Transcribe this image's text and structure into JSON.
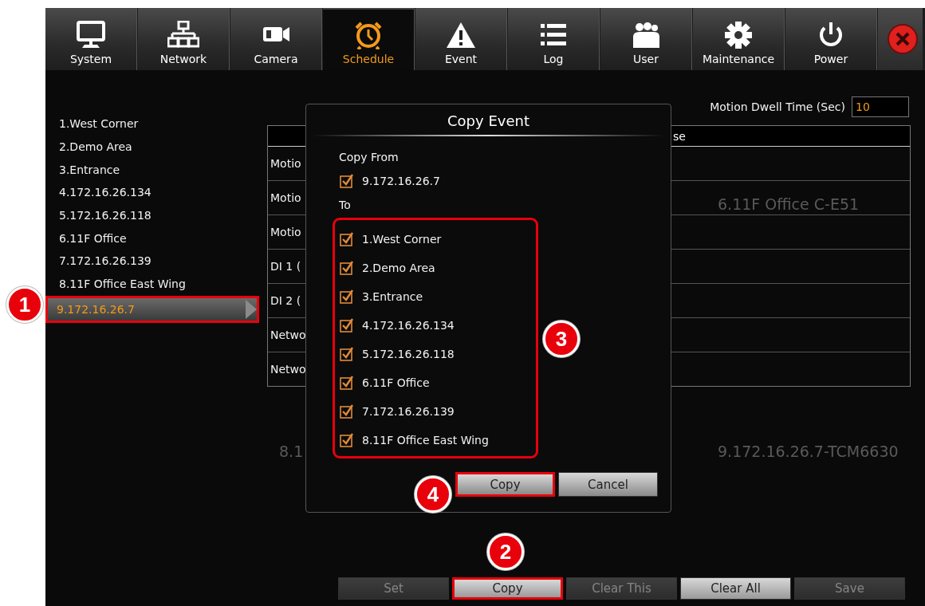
{
  "tabs": [
    {
      "label": "System",
      "selected": false
    },
    {
      "label": "Network",
      "selected": false
    },
    {
      "label": "Camera",
      "selected": false
    },
    {
      "label": "Schedule",
      "selected": true
    },
    {
      "label": "Event",
      "selected": false
    },
    {
      "label": "Log",
      "selected": false
    },
    {
      "label": "User",
      "selected": false
    },
    {
      "label": "Maintenance",
      "selected": false
    },
    {
      "label": "Power",
      "selected": false
    }
  ],
  "camera_list": [
    {
      "label": "1.West Corner",
      "selected": false,
      "highlighted": false
    },
    {
      "label": "2.Demo Area",
      "selected": false,
      "highlighted": false
    },
    {
      "label": "3.Entrance",
      "selected": false,
      "highlighted": false
    },
    {
      "label": "4.172.16.26.134",
      "selected": false,
      "highlighted": false
    },
    {
      "label": "5.172.16.26.118",
      "selected": false,
      "highlighted": false
    },
    {
      "label": "6.11F Office",
      "selected": false,
      "highlighted": false
    },
    {
      "label": "7.172.16.26.139",
      "selected": false,
      "highlighted": false
    },
    {
      "label": "8.11F Office East Wing",
      "selected": false,
      "highlighted": false
    },
    {
      "label": "9.172.16.26.7",
      "selected": true,
      "highlighted": true
    }
  ],
  "motion_dwell_time": {
    "label": "Motion Dwell Time (Sec)",
    "value": "10"
  },
  "event_table": {
    "column_2_header": "se",
    "rows": [
      {
        "column_1": "Motio"
      },
      {
        "column_1": "Motio"
      },
      {
        "column_1": "Motio"
      },
      {
        "column_1": "DI 1 ("
      },
      {
        "column_1": "DI 2 ("
      },
      {
        "column_1": "Netwo"
      },
      {
        "column_1": "Netwo"
      }
    ]
  },
  "background_labels": [
    "6.11F Office C-E51",
    "8.1",
    "9.172.16.26.7-TCM6630"
  ],
  "dialog": {
    "title": "Copy Event",
    "copy_from_label": "Copy From",
    "source": {
      "label": "9.172.16.26.7",
      "checked": true
    },
    "to_label": "To",
    "targets_highlighted": true,
    "targets": [
      {
        "label": "1.West Corner",
        "checked": true
      },
      {
        "label": "2.Demo Area",
        "checked": true
      },
      {
        "label": "3.Entrance",
        "checked": true
      },
      {
        "label": "4.172.16.26.134",
        "checked": true
      },
      {
        "label": "5.172.16.26.118",
        "checked": true
      },
      {
        "label": "6.11F Office",
        "checked": true
      },
      {
        "label": "7.172.16.26.139",
        "checked": true
      },
      {
        "label": "8.11F Office East Wing",
        "checked": true
      }
    ],
    "buttons": [
      {
        "label": "Copy",
        "highlighted": true
      },
      {
        "label": "Cancel",
        "highlighted": false
      }
    ]
  },
  "buttons": [
    {
      "label": "Set",
      "disabled": true,
      "highlighted": false
    },
    {
      "label": "Copy",
      "disabled": false,
      "highlighted": true
    },
    {
      "label": "Clear This",
      "disabled": true,
      "highlighted": false
    },
    {
      "label": "Clear All",
      "disabled": false,
      "highlighted": false
    },
    {
      "label": "Save",
      "disabled": true,
      "highlighted": false
    }
  ],
  "annotations": [
    {
      "number": "1"
    },
    {
      "number": "2"
    },
    {
      "number": "3"
    },
    {
      "number": "4"
    }
  ]
}
